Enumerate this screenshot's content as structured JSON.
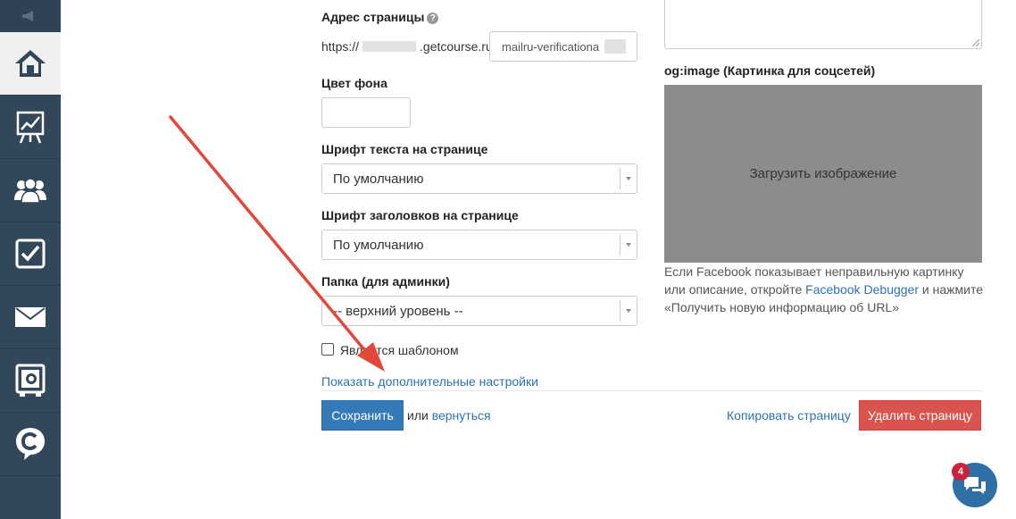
{
  "form": {
    "page_address_label": "Адрес страницы",
    "help_glyph": "?",
    "url_prefix_start": "https://",
    "url_prefix_end": ".getcourse.ru/",
    "url_slug_value": "mailru-verificationa",
    "bg_color_label": "Цвет фона",
    "bg_color_value": "",
    "text_font_label": "Шрифт текста на странице",
    "text_font_value": "По умолчанию",
    "heading_font_label": "Шрифт заголовков на странице",
    "heading_font_value": "По умолчанию",
    "folder_label": "Папка (для админки)",
    "folder_value": "-- верхний уровень --",
    "template_checkbox_label": "Является шаблоном",
    "template_checked": false,
    "show_more_settings": "Показать дополнительные настройки"
  },
  "actions": {
    "save_label": "Сохранить",
    "or_text": "или",
    "back_link": "вернуться",
    "copy_page_link": "Копировать страницу",
    "delete_page_label": "Удалить страницу"
  },
  "og": {
    "label": "og:image (Картинка для соцсетей)",
    "upload_label": "Загрузить изображение",
    "help_part1": "Если Facebook показывает неправильную картинку или описание, откройте",
    "help_link": "Facebook Debugger",
    "help_part2": "и нажмите «Получить новую информацию об URL»"
  },
  "sidebar": {
    "items": [
      {
        "icon": "megaphone-icon"
      },
      {
        "icon": "home-icon"
      },
      {
        "icon": "chart-icon"
      },
      {
        "icon": "users-icon"
      },
      {
        "icon": "checkbox-icon"
      },
      {
        "icon": "mail-icon"
      },
      {
        "icon": "safe-icon"
      },
      {
        "icon": "getcourse-logo-icon"
      }
    ]
  },
  "chat": {
    "unread_count": "4"
  },
  "colors": {
    "sidebar_bg": "#33475b",
    "primary": "#337ab7",
    "danger": "#d9534f",
    "link": "#2d72b1",
    "annotation_arrow": "#e2473a"
  }
}
